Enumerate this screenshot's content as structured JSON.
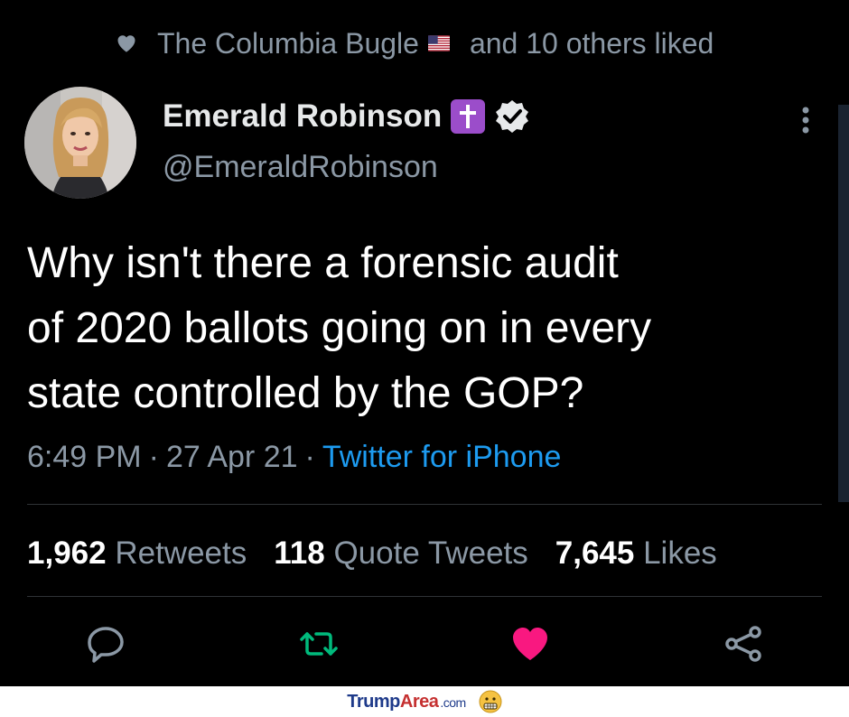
{
  "social_context": {
    "prefix": "The Columbia Bugle",
    "suffix": "and 10 others liked",
    "icon": "heart-icon",
    "flag": "us-flag-emoji"
  },
  "author": {
    "name": "Emerald Robinson",
    "handle": "@EmeraldRobinson",
    "badges": [
      "latin-cross-emoji",
      "verified-badge-icon"
    ]
  },
  "tweet": {
    "text_lines": [
      "Why isn't there a forensic audit",
      "of 2020 ballots going on in every",
      "state controlled by the GOP?"
    ],
    "time": "6:49 PM",
    "date": "27 Apr 21",
    "separator": "·",
    "source": "Twitter for iPhone"
  },
  "stats": {
    "retweets": {
      "count": "1,962",
      "label": "Retweets"
    },
    "quotes": {
      "count": "118",
      "label": "Quote Tweets"
    },
    "likes": {
      "count": "7,645",
      "label": "Likes"
    }
  },
  "actions": [
    "reply-icon",
    "retweet-icon",
    "like-icon",
    "share-icon"
  ],
  "colors": {
    "background": "#000000",
    "text": "#e7e9ea",
    "secondary": "#8b98a5",
    "link": "#1d9bf0",
    "retweet": "#00ba7c",
    "like": "#f91880"
  },
  "watermark": {
    "part1": "Trump",
    "part2": "Area",
    "part3": ".com"
  }
}
